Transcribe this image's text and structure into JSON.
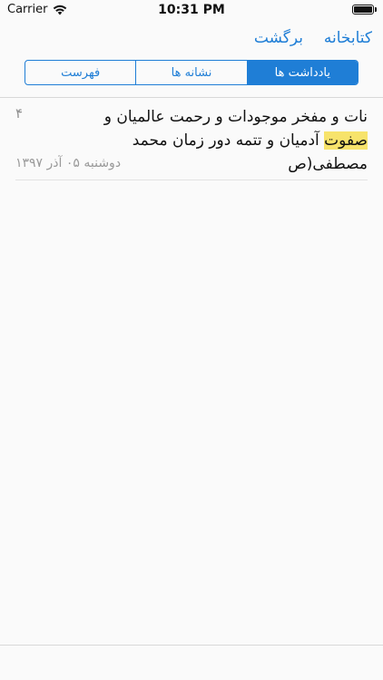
{
  "status_bar": {
    "carrier": "Carrier",
    "time": "10:31 PM",
    "battery_level": 1
  },
  "navigation": {
    "library_label": "کتابخانه",
    "back_label": "برگشت"
  },
  "tabs": [
    {
      "label": "فهرست",
      "active": false
    },
    {
      "label": "نشانه ها",
      "active": false
    },
    {
      "label": "یادداشت ها",
      "active": true
    }
  ],
  "notes": [
    {
      "page": "۴",
      "text_before_highlight": "نات و مفخر موجودات و رحمت عالمیان و ",
      "highlight": "صفوت",
      "text_after_highlight": " آدمیان و تتمه دور زمان محمد مصطفی(ص",
      "date": "دوشنبه ۰۵ آذر ۱۳۹۷"
    }
  ]
}
